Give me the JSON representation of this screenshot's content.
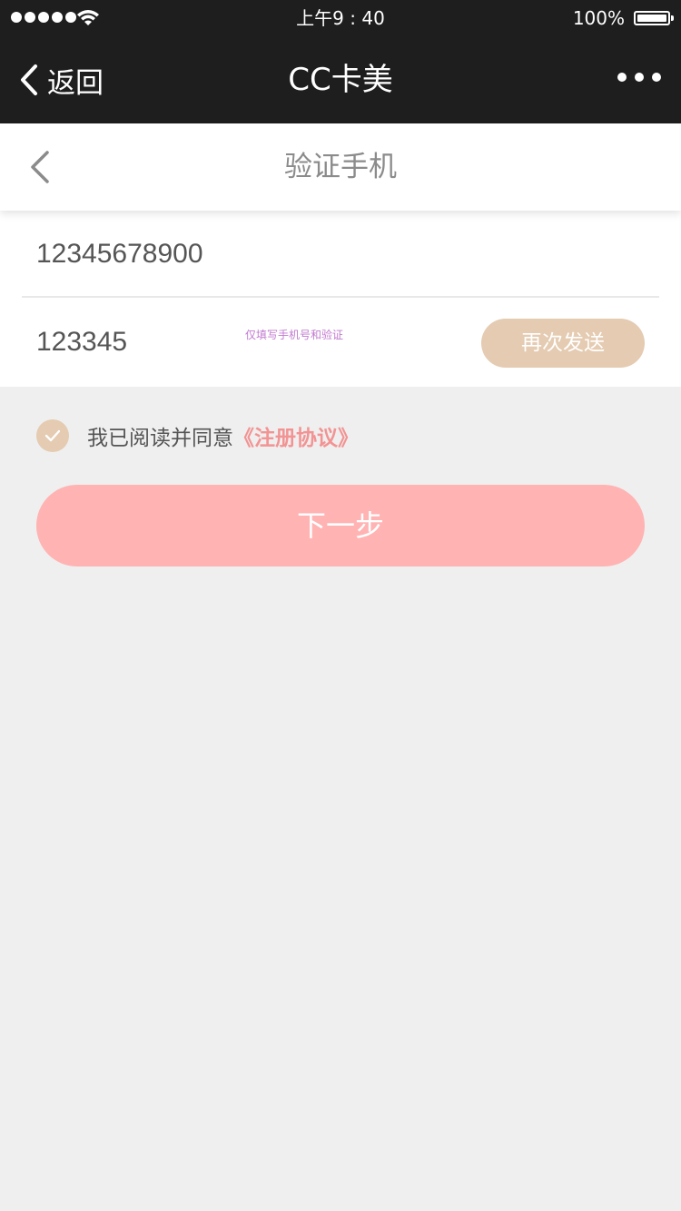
{
  "status_bar": {
    "time": "上午9 : 40",
    "battery_percent": "100%",
    "signal_bars": 5,
    "battery_level": 1.0
  },
  "nav": {
    "back_label": "返回",
    "title": "CC卡美",
    "more_icon": "more-dots-icon"
  },
  "page": {
    "title": "验证手机",
    "back_icon": "chevron-left-icon"
  },
  "form": {
    "phone_value": "12345678900",
    "code_value": "123345",
    "hint": "仅填写手机号和验证",
    "resend_label": "再次发送"
  },
  "agreement": {
    "text": "我已阅读并同意",
    "link": "《注册协议》",
    "checked": true
  },
  "next_label": "下一步",
  "colors": {
    "bar_bg": "#1e1e1e",
    "accent_tan": "#e4cbb1",
    "button_pink": "#ffb3b3",
    "link_pink": "#f39393",
    "hint_purple": "#c27ad0",
    "page_bg": "#efefef"
  }
}
